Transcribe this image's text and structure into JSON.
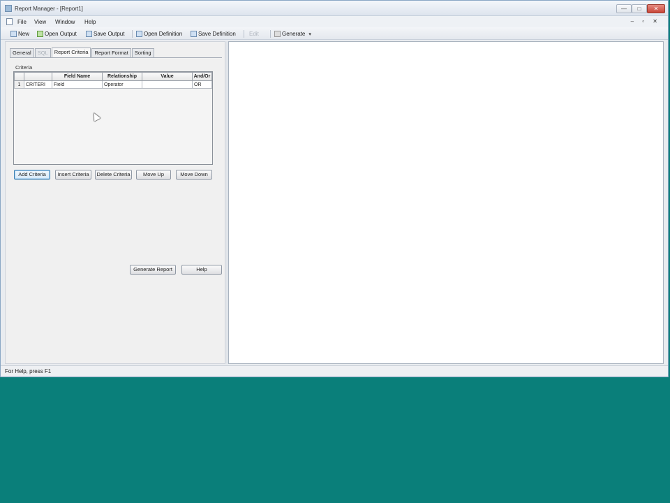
{
  "window": {
    "title": "Report Manager - [Report1]",
    "min_glyph": "—",
    "max_glyph": "□",
    "close_glyph": "✕"
  },
  "menu": {
    "items": [
      "File",
      "View",
      "Window",
      "Help"
    ],
    "mdi_controls": "– ▫ ✕"
  },
  "toolbar": {
    "new": "New",
    "open_output": "Open Output",
    "save_output": "Save Output",
    "open_definition": "Open Definition",
    "save_definition": "Save Definition",
    "disabled_item": "Edit",
    "generate": "Generate",
    "generate_caret": "▾"
  },
  "tabs": [
    "General",
    "SQL",
    "Report Criteria",
    "Report Format",
    "Sorting"
  ],
  "criteria": {
    "group_label": "Criteria",
    "columns": [
      "",
      "",
      "Field Name",
      "Relationship",
      "Value",
      "And/Or"
    ],
    "rows": [
      [
        "1",
        "CRITERI",
        "Field",
        "Operator",
        "",
        "OR"
      ]
    ]
  },
  "buttons": {
    "add_criteria": "Add Criteria",
    "insert_criteria": "Insert Criteria",
    "delete_criteria": "Delete Criteria",
    "move_up": "Move Up",
    "move_down": "Move Down",
    "generate_report": "Generate Report",
    "help": "Help"
  },
  "status": {
    "text": "For Help, press F1"
  },
  "colors": {
    "desktop": "#0a7f7a",
    "window_bg": "#e9ecf0",
    "close_button": "#c8473a",
    "focus_accent": "#3c7fb1"
  }
}
